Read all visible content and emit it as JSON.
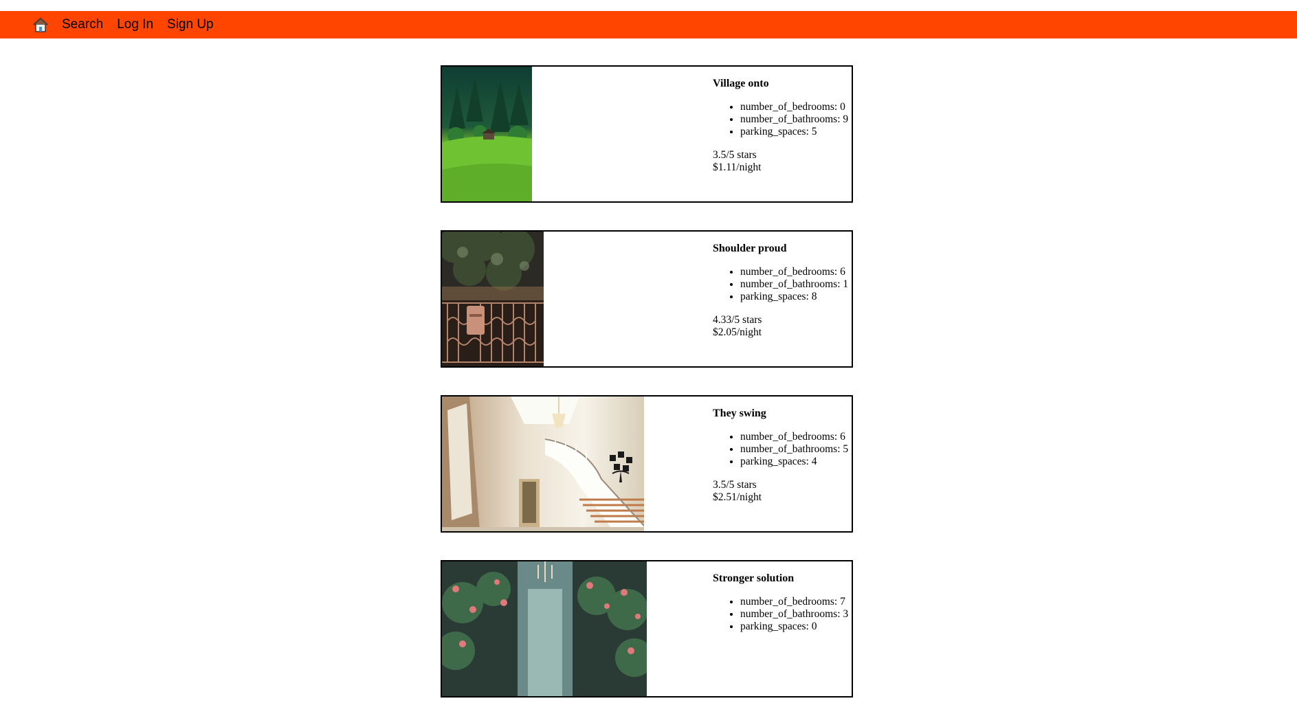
{
  "nav": {
    "home_icon": "home-icon",
    "search_label": "Search",
    "login_label": "Log In",
    "signup_label": "Sign Up"
  },
  "colors": {
    "navbar": "#ff4500"
  },
  "listings": [
    {
      "title": "Village onto",
      "bedrooms": "number_of_bedrooms: 0",
      "bathrooms": "number_of_bathrooms: 9",
      "parking": "parking_spaces: 5",
      "rating": "3.5/5 stars",
      "price": "$1.11/night",
      "photo": "forest-hillside-cabin"
    },
    {
      "title": "Shoulder proud",
      "bedrooms": "number_of_bedrooms: 6",
      "bathrooms": "number_of_bathrooms: 1",
      "parking": "parking_spaces: 8",
      "rating": "4.33/5 stars",
      "price": "$2.05/night",
      "photo": "iron-gate-with-tree"
    },
    {
      "title": "They swing",
      "bedrooms": "number_of_bedrooms: 6",
      "bathrooms": "number_of_bathrooms: 5",
      "parking": "parking_spaces: 4",
      "rating": "3.5/5 stars",
      "price": "$2.51/night",
      "photo": "interior-staircase-chandelier"
    },
    {
      "title": "Stronger solution",
      "bedrooms": "number_of_bedrooms: 7",
      "bathrooms": "number_of_bathrooms: 3",
      "parking": "parking_spaces: 0",
      "rating": "",
      "price": "",
      "photo": "flowers-and-chandelier"
    }
  ]
}
